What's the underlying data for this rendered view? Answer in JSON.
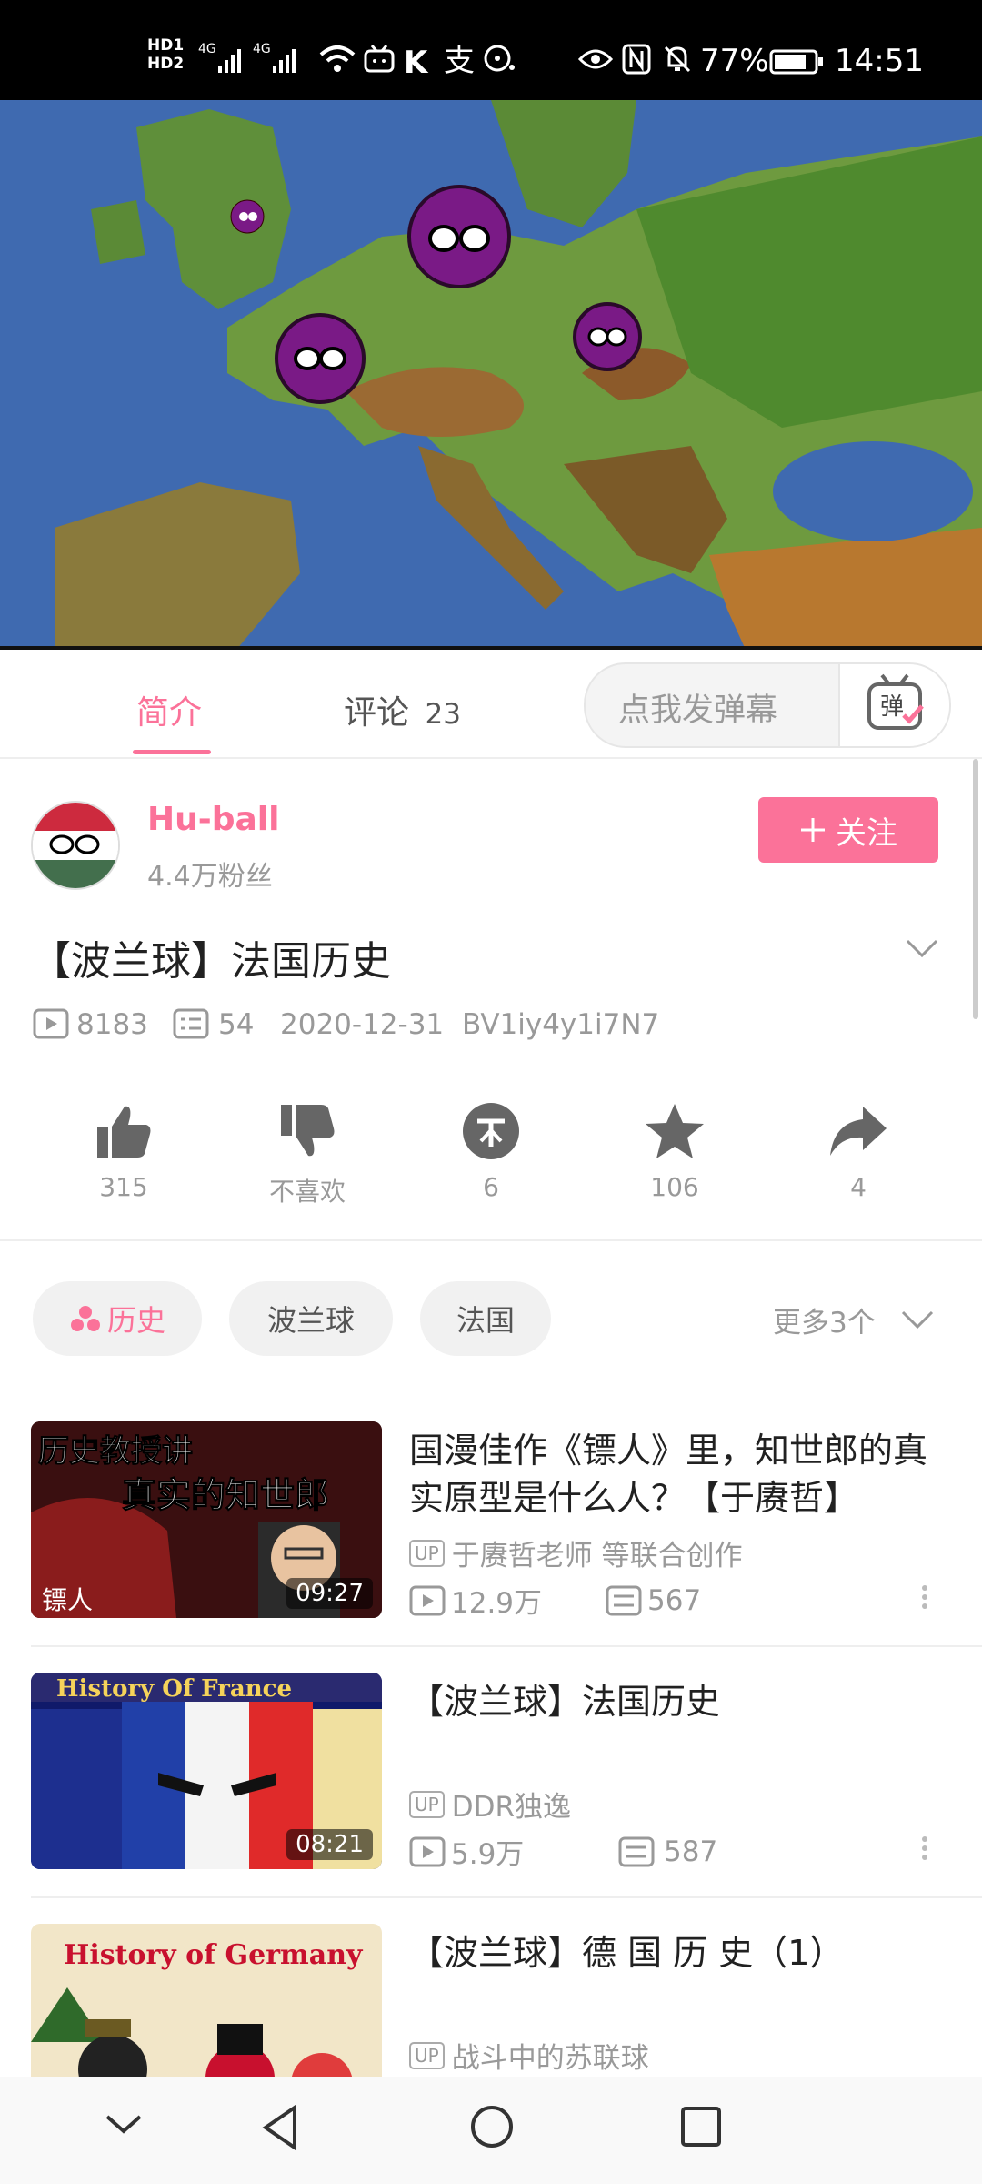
{
  "status_bar": {
    "hd1": "HD1",
    "hd2": "HD2",
    "network": "4G",
    "battery": "77%",
    "time": "14:51",
    "icons": [
      "signal-icon",
      "wifi-icon",
      "tv-app-icon",
      "k-app-icon",
      "alipay-icon",
      "chat-icon",
      "eye-icon",
      "nfc-icon",
      "mute-icon",
      "battery-icon"
    ]
  },
  "tabs": {
    "intro": "简介",
    "comments": "评论",
    "comments_count": "23",
    "danmaku_placeholder": "点我发弹幕",
    "danmaku_button": "弹"
  },
  "author": {
    "name": "Hu-ball",
    "fans": "4.4万粉丝",
    "follow_label": "关注"
  },
  "video": {
    "title": "【波兰球】法国历史",
    "views": "8183",
    "danmaku": "54",
    "date": "2020-12-31",
    "bvid": "BV1iy4y1i7N7"
  },
  "actions": {
    "like": "315",
    "dislike": "不喜欢",
    "coin": "6",
    "favorite": "106",
    "share": "4"
  },
  "tags": {
    "items": [
      "历史",
      "波兰球",
      "法国"
    ],
    "more": "更多3个"
  },
  "recommendations": [
    {
      "title": "国漫佳作《镖人》里，知世郎的真实原型是什么人？【于赓哲】",
      "thumb_text_1": "历史教授讲",
      "thumb_text_2": "真实的知世郎",
      "thumb_corner": "镖人",
      "duration": "09:27",
      "up_badge": "UP",
      "up": "于赓哲老师 等联合创作",
      "views": "12.9万",
      "danmaku": "567"
    },
    {
      "title": "【波兰球】法国历史",
      "thumb_text_1": "History Of France",
      "duration": "08:21",
      "up_badge": "UP",
      "up": "DDR独逸",
      "views": "5.9万",
      "danmaku": "587"
    },
    {
      "title": "【波兰球】德 国 历 史（1）",
      "thumb_text_1": "History of Germany",
      "up_badge": "UP",
      "up": "战斗中的苏联球"
    }
  ],
  "colors": {
    "accent": "#fb7299",
    "status_bar": "#000000",
    "purple_ball": "#7a1a86"
  }
}
